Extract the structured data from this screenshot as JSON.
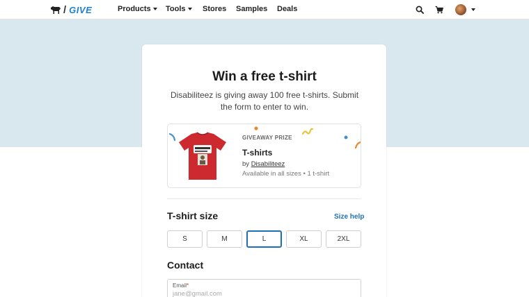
{
  "nav": {
    "logo_text": "GIVE",
    "links": [
      {
        "label": "Products",
        "dropdown": true
      },
      {
        "label": "Tools",
        "dropdown": true
      },
      {
        "label": "Stores",
        "dropdown": false
      },
      {
        "label": "Samples",
        "dropdown": false
      },
      {
        "label": "Deals",
        "dropdown": false
      }
    ],
    "icons": [
      "search-icon",
      "cart-icon",
      "avatar"
    ]
  },
  "giveaway": {
    "title": "Win a free t-shirt",
    "subtitle": "Disabiliteez is giving away 100 free t-shirts. Submit the form to enter to win.",
    "prize": {
      "label": "GIVEAWAY PRIZE",
      "name": "T-shirts",
      "by_prefix": "by",
      "store": "Disabiliteez",
      "availability": "Available in all sizes • 1 t-shirt"
    }
  },
  "size_section": {
    "title": "T-shirt size",
    "help_link": "Size help",
    "sizes": [
      "S",
      "M",
      "L",
      "XL",
      "2XL"
    ],
    "selected": "L"
  },
  "contact": {
    "title": "Contact",
    "email_label": "Email",
    "email_required": "*",
    "email_placeholder": "jane@gmail.com"
  },
  "colors": {
    "accent": "#1f6fb8",
    "hero_bg": "#d9e7ee",
    "shirt": "#cc2a2f"
  }
}
